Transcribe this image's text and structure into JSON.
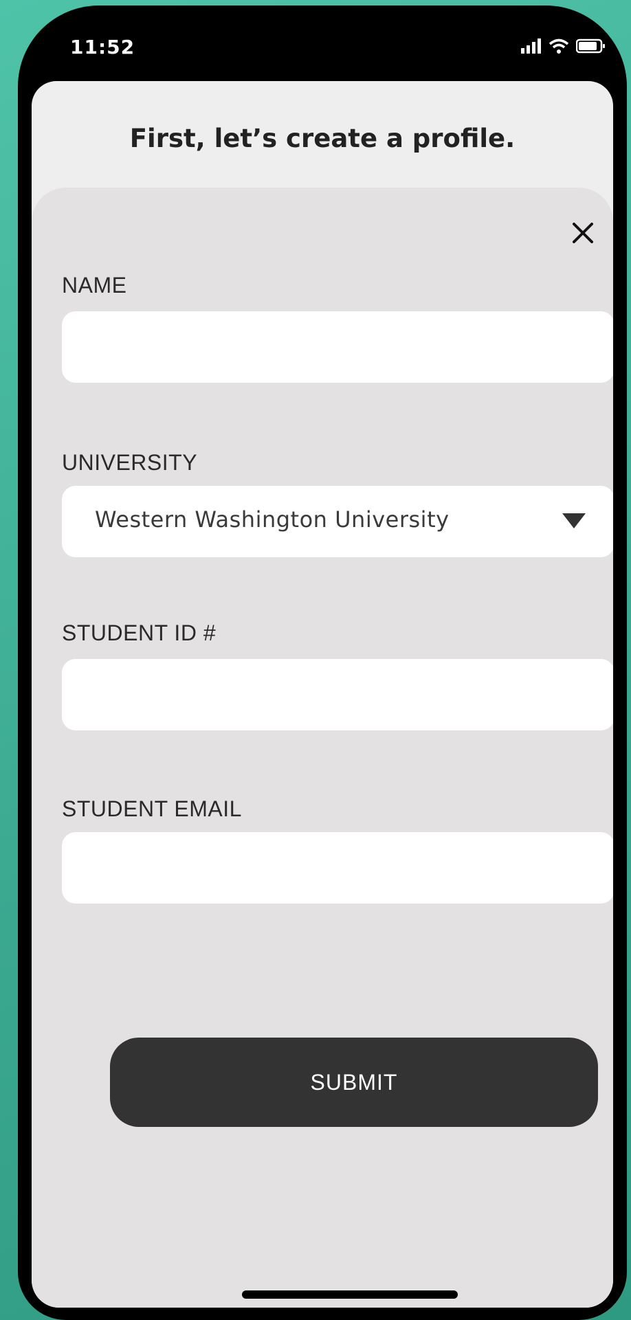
{
  "status_bar": {
    "time": "11:52",
    "icons": [
      "cellular-signal-icon",
      "wifi-icon",
      "battery-icon"
    ]
  },
  "header": {
    "title": "First, let’s create a profile."
  },
  "form": {
    "close_icon": "close-icon",
    "fields": {
      "name": {
        "label": "NAME",
        "value": ""
      },
      "university": {
        "label": "UNIVERSITY",
        "selected": "Western Washington University",
        "icon": "dropdown-triangle-icon"
      },
      "student_id": {
        "label": "STUDENT ID #",
        "value": ""
      },
      "student_email": {
        "label": "STUDENT EMAIL",
        "value": ""
      }
    },
    "submit_label": "SUBMIT"
  },
  "colors": {
    "background": "#3aa88f",
    "screen": "#efeeef",
    "sheet": "#e3e1e2",
    "button": "#333333"
  }
}
